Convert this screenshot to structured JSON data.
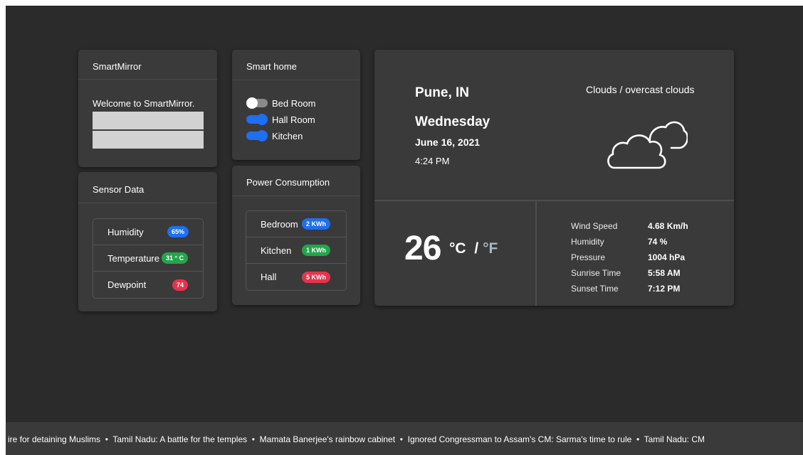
{
  "smart_mirror": {
    "title": "SmartMirror",
    "welcome": "Welcome to SmartMirror."
  },
  "smart_home": {
    "title": "Smart home",
    "devices": [
      {
        "label": "Bed Room",
        "state": "off"
      },
      {
        "label": "Hall Room",
        "state": "on"
      },
      {
        "label": "Kitchen",
        "state": "on"
      }
    ]
  },
  "sensor": {
    "title": "Sensor Data",
    "rows": [
      {
        "label": "Humidity",
        "value": "65%",
        "color": "#1e6ff1"
      },
      {
        "label": "Temperature",
        "value": "31 ° C",
        "color": "#22a64a"
      },
      {
        "label": "Dewpoint",
        "value": "74",
        "color": "#e8324b"
      }
    ]
  },
  "power": {
    "title": "Power Consumption",
    "rows": [
      {
        "label": "Bedroom",
        "value": "2 KWh",
        "color": "#1e6ff1"
      },
      {
        "label": "Kitchen",
        "value": "1 KWh",
        "color": "#22a64a"
      },
      {
        "label": "Hall",
        "value": "5 KWh",
        "color": "#e8324b"
      }
    ]
  },
  "weather": {
    "city": "Pune, IN",
    "day": "Wednesday",
    "date": "June 16, 2021",
    "time": "4:24 PM",
    "description": "Clouds / overcast clouds",
    "icon": "clouds-icon",
    "temperature": "26",
    "unit_c": "°C",
    "unit_sep": "/",
    "unit_f": "°F",
    "stats": [
      {
        "label": "Wind Speed",
        "value": "4.68 Km/h"
      },
      {
        "label": "Humidity",
        "value": "74 %"
      },
      {
        "label": "Pressure",
        "value": "1004 hPa"
      },
      {
        "label": "Sunrise Time",
        "value": "5:58 AM"
      },
      {
        "label": "Sunset Time",
        "value": "7:12 PM"
      }
    ]
  },
  "ticker": {
    "text": "ire for detaining Muslims  •  Tamil Nadu: A battle for the temples  •  Mamata Banerjee's rainbow cabinet  •  Ignored Congressman to Assam's CM: Sarma's time to rule  •  Tamil Nadu: CM"
  }
}
